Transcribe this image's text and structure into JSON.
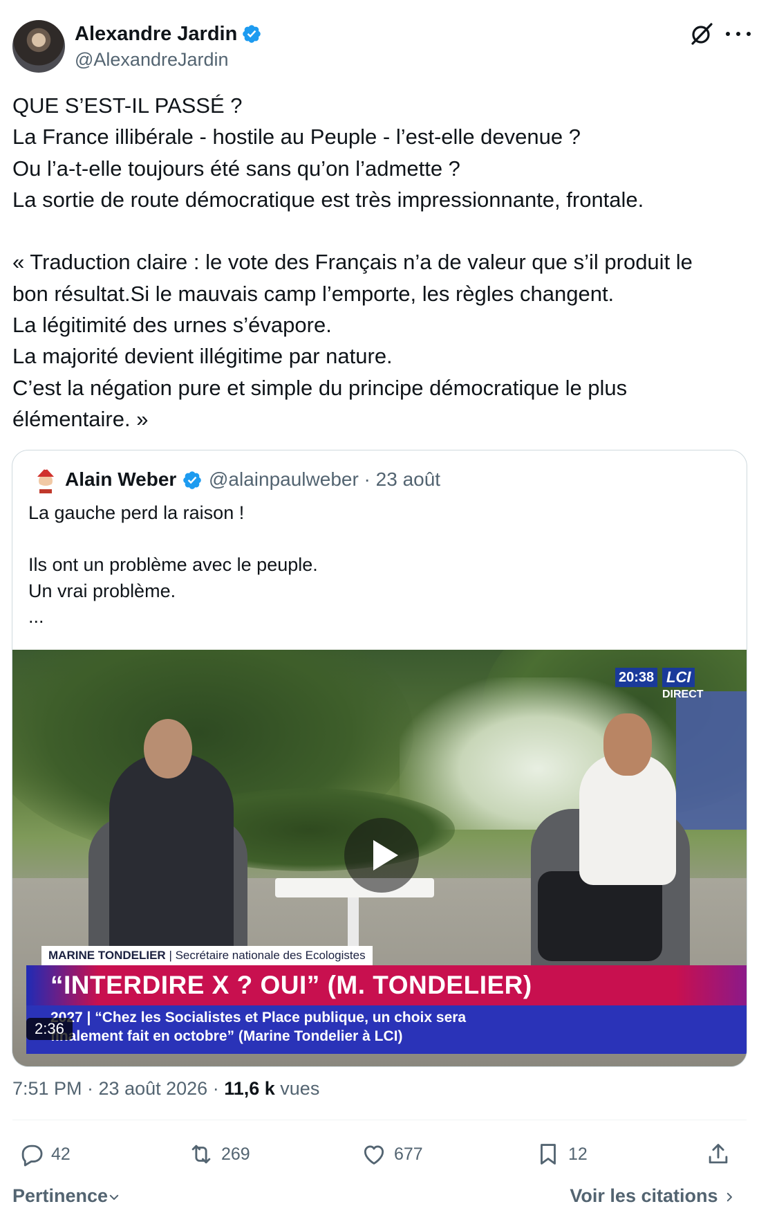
{
  "author": {
    "name": "Alexandre Jardin",
    "handle": "@AlexandreJardin"
  },
  "tweet_lines_1": [
    "QUE S’EST-IL PASSÉ ?",
    "La France illibérale - hostile au Peuple - l’est-elle devenue ?",
    "Ou l’a-t-elle toujours été sans qu’on l’admette ?",
    "La sortie de route démocratique est très impressionnante, frontale."
  ],
  "tweet_lines_2": [
    "« Traduction claire : le vote des Français n’a de valeur que s’il produit le",
    "bon résultat.Si le mauvais camp l’emporte, les règles changent.",
    "La légitimité des urnes s’évapore.",
    "La majorité devient illégitime par nature.",
    "C’est la négation pure et simple du principe démocratique le plus",
    "élémentaire. »"
  ],
  "quote": {
    "name": "Alain Weber",
    "meta": "@alainpaulweber · 23 août",
    "line1": "La gauche perd la raison !",
    "line2": "Ils ont un problème avec le peuple.",
    "line3": "Un vrai problème.",
    "line4": "..."
  },
  "video": {
    "time": "20:38",
    "logo": "LCI",
    "live": "DIRECT",
    "name_bold": "MARINE TONDELIER",
    "name_role": "| Secrétaire nationale des Ecologistes",
    "headline": "“INTERDIRE X ? OUI” (M. TONDELIER)",
    "ticker1": "2027 | “Chez les Socialistes et Place publique, un choix sera",
    "ticker2": "finalement fait en octobre” (Marine Tondelier à LCI)",
    "duration": "2:36"
  },
  "meta": {
    "time_date": "7:51 PM · 23 août 2026 · ",
    "views_count": "11,6 k",
    "views_label": " vues"
  },
  "actions": {
    "replies": "42",
    "reposts": "269",
    "likes": "677",
    "bookmarks": "12"
  },
  "footer": {
    "sort_label": "Pertinence",
    "quotes_label": "Voir les citations"
  },
  "colors": {
    "text": "#0f1419",
    "secondary": "#536471",
    "verified": "#1d9bf0",
    "border": "#cfd9de",
    "lci_blue": "#1a3a9a",
    "headline_red": "#c8104f"
  }
}
